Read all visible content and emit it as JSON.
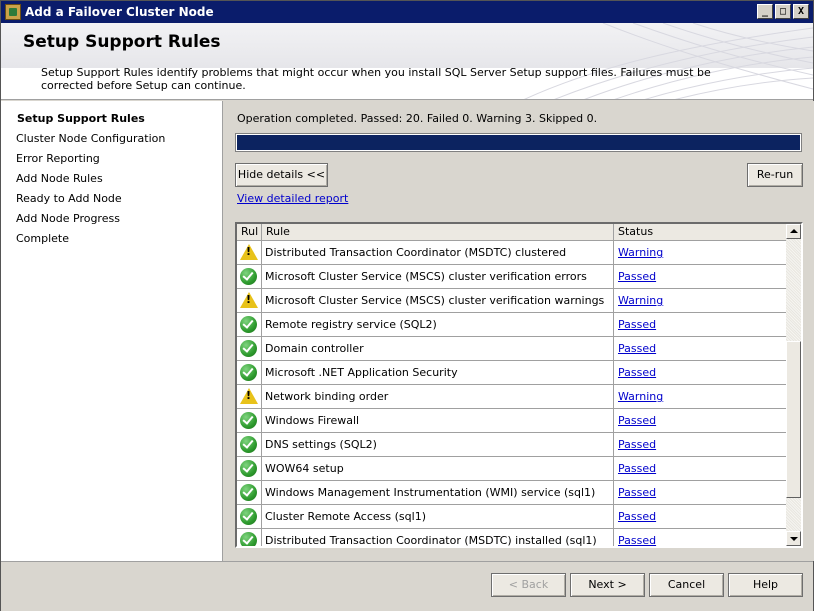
{
  "window": {
    "title": "Add a Failover Cluster Node",
    "min_glyph": "_",
    "max_glyph": "□",
    "close_glyph": "X"
  },
  "header": {
    "title": "Setup Support Rules",
    "description": "Setup Support Rules identify problems that might occur when you install SQL Server Setup support files. Failures must be corrected before Setup can continue."
  },
  "nav": {
    "items": [
      {
        "label": "Setup Support Rules",
        "active": true
      },
      {
        "label": "Cluster Node Configuration",
        "active": false
      },
      {
        "label": "Error Reporting",
        "active": false
      },
      {
        "label": "Add Node Rules",
        "active": false
      },
      {
        "label": "Ready to Add Node",
        "active": false
      },
      {
        "label": "Add Node Progress",
        "active": false
      },
      {
        "label": "Complete",
        "active": false
      }
    ]
  },
  "main": {
    "status_text": "Operation completed. Passed: 20.   Failed 0.   Warning 3.   Skipped 0.",
    "progress_fraction": 1.0,
    "hide_details_label": "Hide details <<",
    "rerun_label": "Re-run",
    "view_report_label": "View detailed report"
  },
  "grid": {
    "columns": [
      "Rul",
      "Rule",
      "Status"
    ],
    "rows": [
      {
        "icon": "warning-icon",
        "rule": "Distributed Transaction Coordinator (MSDTC) clustered",
        "status": "Warning"
      },
      {
        "icon": "passed-check-icon",
        "rule": "Microsoft Cluster Service (MSCS) cluster verification errors",
        "status": "Passed"
      },
      {
        "icon": "warning-icon",
        "rule": "Microsoft Cluster Service (MSCS) cluster verification warnings",
        "status": "Warning"
      },
      {
        "icon": "passed-check-icon",
        "rule": "Remote registry service (SQL2)",
        "status": "Passed"
      },
      {
        "icon": "passed-check-icon",
        "rule": "Domain controller",
        "status": "Passed"
      },
      {
        "icon": "passed-check-icon",
        "rule": "Microsoft .NET Application Security",
        "status": "Passed"
      },
      {
        "icon": "warning-icon",
        "rule": "Network binding order",
        "status": "Warning"
      },
      {
        "icon": "passed-check-icon",
        "rule": "Windows Firewall",
        "status": "Passed"
      },
      {
        "icon": "passed-check-icon",
        "rule": "DNS settings (SQL2)",
        "status": "Passed"
      },
      {
        "icon": "passed-check-icon",
        "rule": "WOW64 setup",
        "status": "Passed"
      },
      {
        "icon": "passed-check-icon",
        "rule": "Windows Management Instrumentation (WMI) service (sql1)",
        "status": "Passed"
      },
      {
        "icon": "passed-check-icon",
        "rule": "Cluster Remote Access (sql1)",
        "status": "Passed"
      },
      {
        "icon": "passed-check-icon",
        "rule": "Distributed Transaction Coordinator (MSDTC) installed (sql1)",
        "status": "Passed"
      }
    ]
  },
  "footer": {
    "back_label": "< Back",
    "next_label": "Next >",
    "cancel_label": "Cancel",
    "help_label": "Help"
  },
  "colors": {
    "titlebar": "#0a1c6b",
    "progress_fill": "#0c2360",
    "link": "#0000cc"
  }
}
